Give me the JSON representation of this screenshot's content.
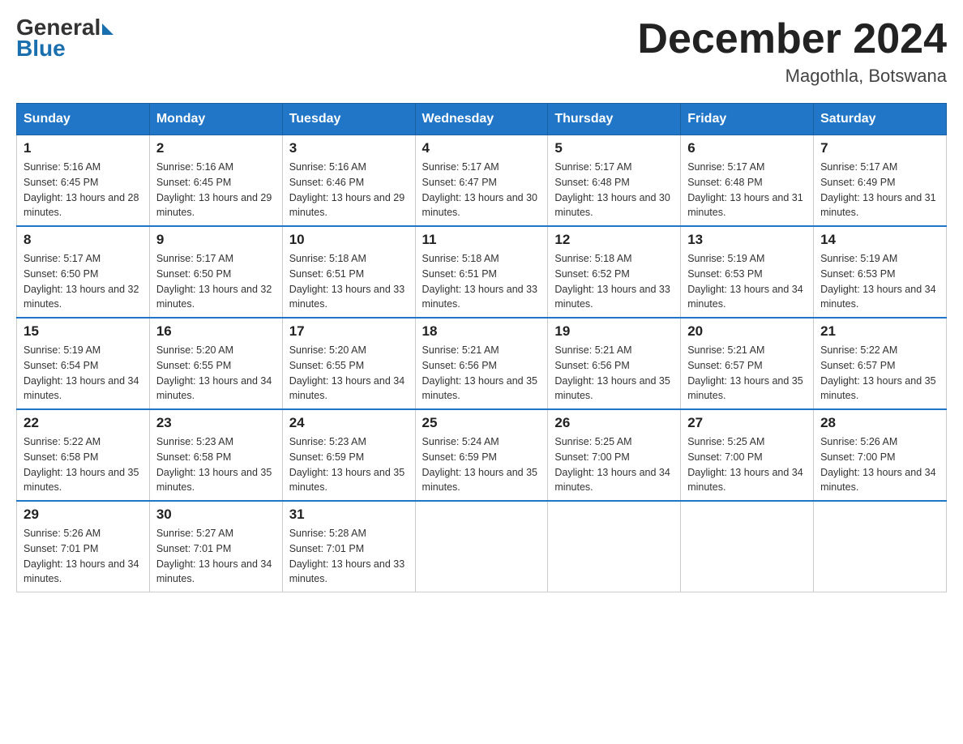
{
  "header": {
    "logo_line1": "General",
    "logo_line2": "Blue",
    "month_title": "December 2024",
    "location": "Magothla, Botswana"
  },
  "weekdays": [
    "Sunday",
    "Monday",
    "Tuesday",
    "Wednesday",
    "Thursday",
    "Friday",
    "Saturday"
  ],
  "weeks": [
    [
      {
        "day": "1",
        "sunrise": "Sunrise: 5:16 AM",
        "sunset": "Sunset: 6:45 PM",
        "daylight": "Daylight: 13 hours and 28 minutes."
      },
      {
        "day": "2",
        "sunrise": "Sunrise: 5:16 AM",
        "sunset": "Sunset: 6:45 PM",
        "daylight": "Daylight: 13 hours and 29 minutes."
      },
      {
        "day": "3",
        "sunrise": "Sunrise: 5:16 AM",
        "sunset": "Sunset: 6:46 PM",
        "daylight": "Daylight: 13 hours and 29 minutes."
      },
      {
        "day": "4",
        "sunrise": "Sunrise: 5:17 AM",
        "sunset": "Sunset: 6:47 PM",
        "daylight": "Daylight: 13 hours and 30 minutes."
      },
      {
        "day": "5",
        "sunrise": "Sunrise: 5:17 AM",
        "sunset": "Sunset: 6:48 PM",
        "daylight": "Daylight: 13 hours and 30 minutes."
      },
      {
        "day": "6",
        "sunrise": "Sunrise: 5:17 AM",
        "sunset": "Sunset: 6:48 PM",
        "daylight": "Daylight: 13 hours and 31 minutes."
      },
      {
        "day": "7",
        "sunrise": "Sunrise: 5:17 AM",
        "sunset": "Sunset: 6:49 PM",
        "daylight": "Daylight: 13 hours and 31 minutes."
      }
    ],
    [
      {
        "day": "8",
        "sunrise": "Sunrise: 5:17 AM",
        "sunset": "Sunset: 6:50 PM",
        "daylight": "Daylight: 13 hours and 32 minutes."
      },
      {
        "day": "9",
        "sunrise": "Sunrise: 5:17 AM",
        "sunset": "Sunset: 6:50 PM",
        "daylight": "Daylight: 13 hours and 32 minutes."
      },
      {
        "day": "10",
        "sunrise": "Sunrise: 5:18 AM",
        "sunset": "Sunset: 6:51 PM",
        "daylight": "Daylight: 13 hours and 33 minutes."
      },
      {
        "day": "11",
        "sunrise": "Sunrise: 5:18 AM",
        "sunset": "Sunset: 6:51 PM",
        "daylight": "Daylight: 13 hours and 33 minutes."
      },
      {
        "day": "12",
        "sunrise": "Sunrise: 5:18 AM",
        "sunset": "Sunset: 6:52 PM",
        "daylight": "Daylight: 13 hours and 33 minutes."
      },
      {
        "day": "13",
        "sunrise": "Sunrise: 5:19 AM",
        "sunset": "Sunset: 6:53 PM",
        "daylight": "Daylight: 13 hours and 34 minutes."
      },
      {
        "day": "14",
        "sunrise": "Sunrise: 5:19 AM",
        "sunset": "Sunset: 6:53 PM",
        "daylight": "Daylight: 13 hours and 34 minutes."
      }
    ],
    [
      {
        "day": "15",
        "sunrise": "Sunrise: 5:19 AM",
        "sunset": "Sunset: 6:54 PM",
        "daylight": "Daylight: 13 hours and 34 minutes."
      },
      {
        "day": "16",
        "sunrise": "Sunrise: 5:20 AM",
        "sunset": "Sunset: 6:55 PM",
        "daylight": "Daylight: 13 hours and 34 minutes."
      },
      {
        "day": "17",
        "sunrise": "Sunrise: 5:20 AM",
        "sunset": "Sunset: 6:55 PM",
        "daylight": "Daylight: 13 hours and 34 minutes."
      },
      {
        "day": "18",
        "sunrise": "Sunrise: 5:21 AM",
        "sunset": "Sunset: 6:56 PM",
        "daylight": "Daylight: 13 hours and 35 minutes."
      },
      {
        "day": "19",
        "sunrise": "Sunrise: 5:21 AM",
        "sunset": "Sunset: 6:56 PM",
        "daylight": "Daylight: 13 hours and 35 minutes."
      },
      {
        "day": "20",
        "sunrise": "Sunrise: 5:21 AM",
        "sunset": "Sunset: 6:57 PM",
        "daylight": "Daylight: 13 hours and 35 minutes."
      },
      {
        "day": "21",
        "sunrise": "Sunrise: 5:22 AM",
        "sunset": "Sunset: 6:57 PM",
        "daylight": "Daylight: 13 hours and 35 minutes."
      }
    ],
    [
      {
        "day": "22",
        "sunrise": "Sunrise: 5:22 AM",
        "sunset": "Sunset: 6:58 PM",
        "daylight": "Daylight: 13 hours and 35 minutes."
      },
      {
        "day": "23",
        "sunrise": "Sunrise: 5:23 AM",
        "sunset": "Sunset: 6:58 PM",
        "daylight": "Daylight: 13 hours and 35 minutes."
      },
      {
        "day": "24",
        "sunrise": "Sunrise: 5:23 AM",
        "sunset": "Sunset: 6:59 PM",
        "daylight": "Daylight: 13 hours and 35 minutes."
      },
      {
        "day": "25",
        "sunrise": "Sunrise: 5:24 AM",
        "sunset": "Sunset: 6:59 PM",
        "daylight": "Daylight: 13 hours and 35 minutes."
      },
      {
        "day": "26",
        "sunrise": "Sunrise: 5:25 AM",
        "sunset": "Sunset: 7:00 PM",
        "daylight": "Daylight: 13 hours and 34 minutes."
      },
      {
        "day": "27",
        "sunrise": "Sunrise: 5:25 AM",
        "sunset": "Sunset: 7:00 PM",
        "daylight": "Daylight: 13 hours and 34 minutes."
      },
      {
        "day": "28",
        "sunrise": "Sunrise: 5:26 AM",
        "sunset": "Sunset: 7:00 PM",
        "daylight": "Daylight: 13 hours and 34 minutes."
      }
    ],
    [
      {
        "day": "29",
        "sunrise": "Sunrise: 5:26 AM",
        "sunset": "Sunset: 7:01 PM",
        "daylight": "Daylight: 13 hours and 34 minutes."
      },
      {
        "day": "30",
        "sunrise": "Sunrise: 5:27 AM",
        "sunset": "Sunset: 7:01 PM",
        "daylight": "Daylight: 13 hours and 34 minutes."
      },
      {
        "day": "31",
        "sunrise": "Sunrise: 5:28 AM",
        "sunset": "Sunset: 7:01 PM",
        "daylight": "Daylight: 13 hours and 33 minutes."
      },
      null,
      null,
      null,
      null
    ]
  ]
}
